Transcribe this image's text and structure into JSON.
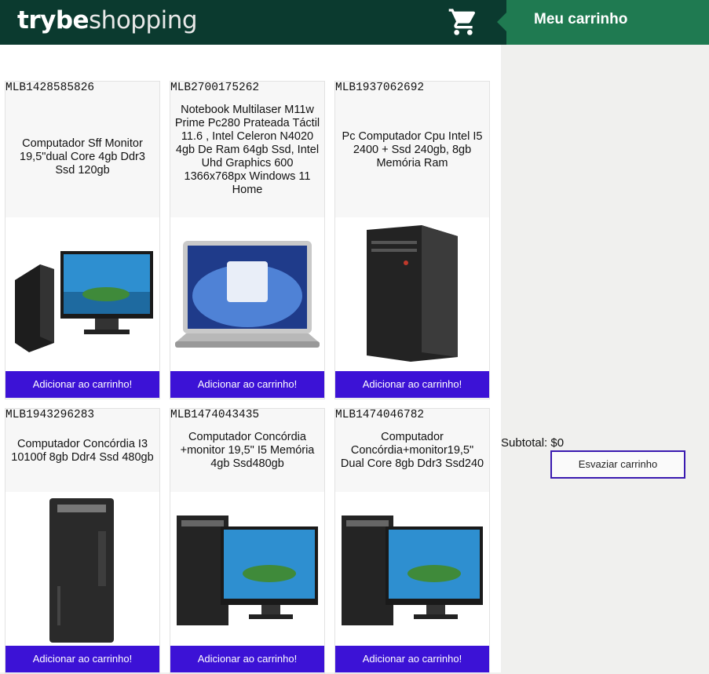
{
  "header": {
    "logo_bold": "trybe",
    "logo_light": "shopping",
    "cart_tab_label": "Meu carrinho"
  },
  "icons": {
    "cart": "shopping-cart-icon"
  },
  "colors": {
    "header_bg": "#0b3a2f",
    "cart_tab_bg": "#1f7a51",
    "button_bg": "#3c12d6"
  },
  "products": [
    {
      "id": "MLB1428585826",
      "title": "Computador Sff Monitor 19,5\"dual Core 4gb Ddr3 Ssd 120gb",
      "button": "Adicionar ao carrinho!",
      "image": "desktop-with-monitor"
    },
    {
      "id": "MLB2700175262",
      "title": "Notebook Multilaser M11w Prime Pc280 Prateada Táctil 11.6 , Intel Celeron N4020 4gb De Ram 64gb Ssd, Intel Uhd Graphics 600 1366x768px Windows 11 Home",
      "button": "Adicionar ao carrinho!",
      "image": "laptop"
    },
    {
      "id": "MLB1937062692",
      "title": "Pc Computador Cpu Intel I5 2400 + Ssd 240gb, 8gb Memória Ram",
      "button": "Adicionar ao carrinho!",
      "image": "tower-case"
    },
    {
      "id": "MLB1943296283",
      "title": "Computador Concórdia I3 10100f 8gb Ddr4 Ssd 480gb",
      "button": "Adicionar ao carrinho!",
      "image": "tower-case"
    },
    {
      "id": "MLB1474043435",
      "title": "Computador Concórdia +monitor 19,5\" I5 Memória 4gb Ssd480gb",
      "button": "Adicionar ao carrinho!",
      "image": "desktop-with-monitor"
    },
    {
      "id": "MLB1474046782",
      "title": "Computador Concórdia+monitor19,5\" Dual Core 8gb Ddr3 Ssd240",
      "button": "Adicionar ao carrinho!",
      "image": "desktop-with-monitor"
    }
  ],
  "cart": {
    "subtotal": "Subtotal: $0",
    "empty_button": "Esvaziar carrinho"
  }
}
